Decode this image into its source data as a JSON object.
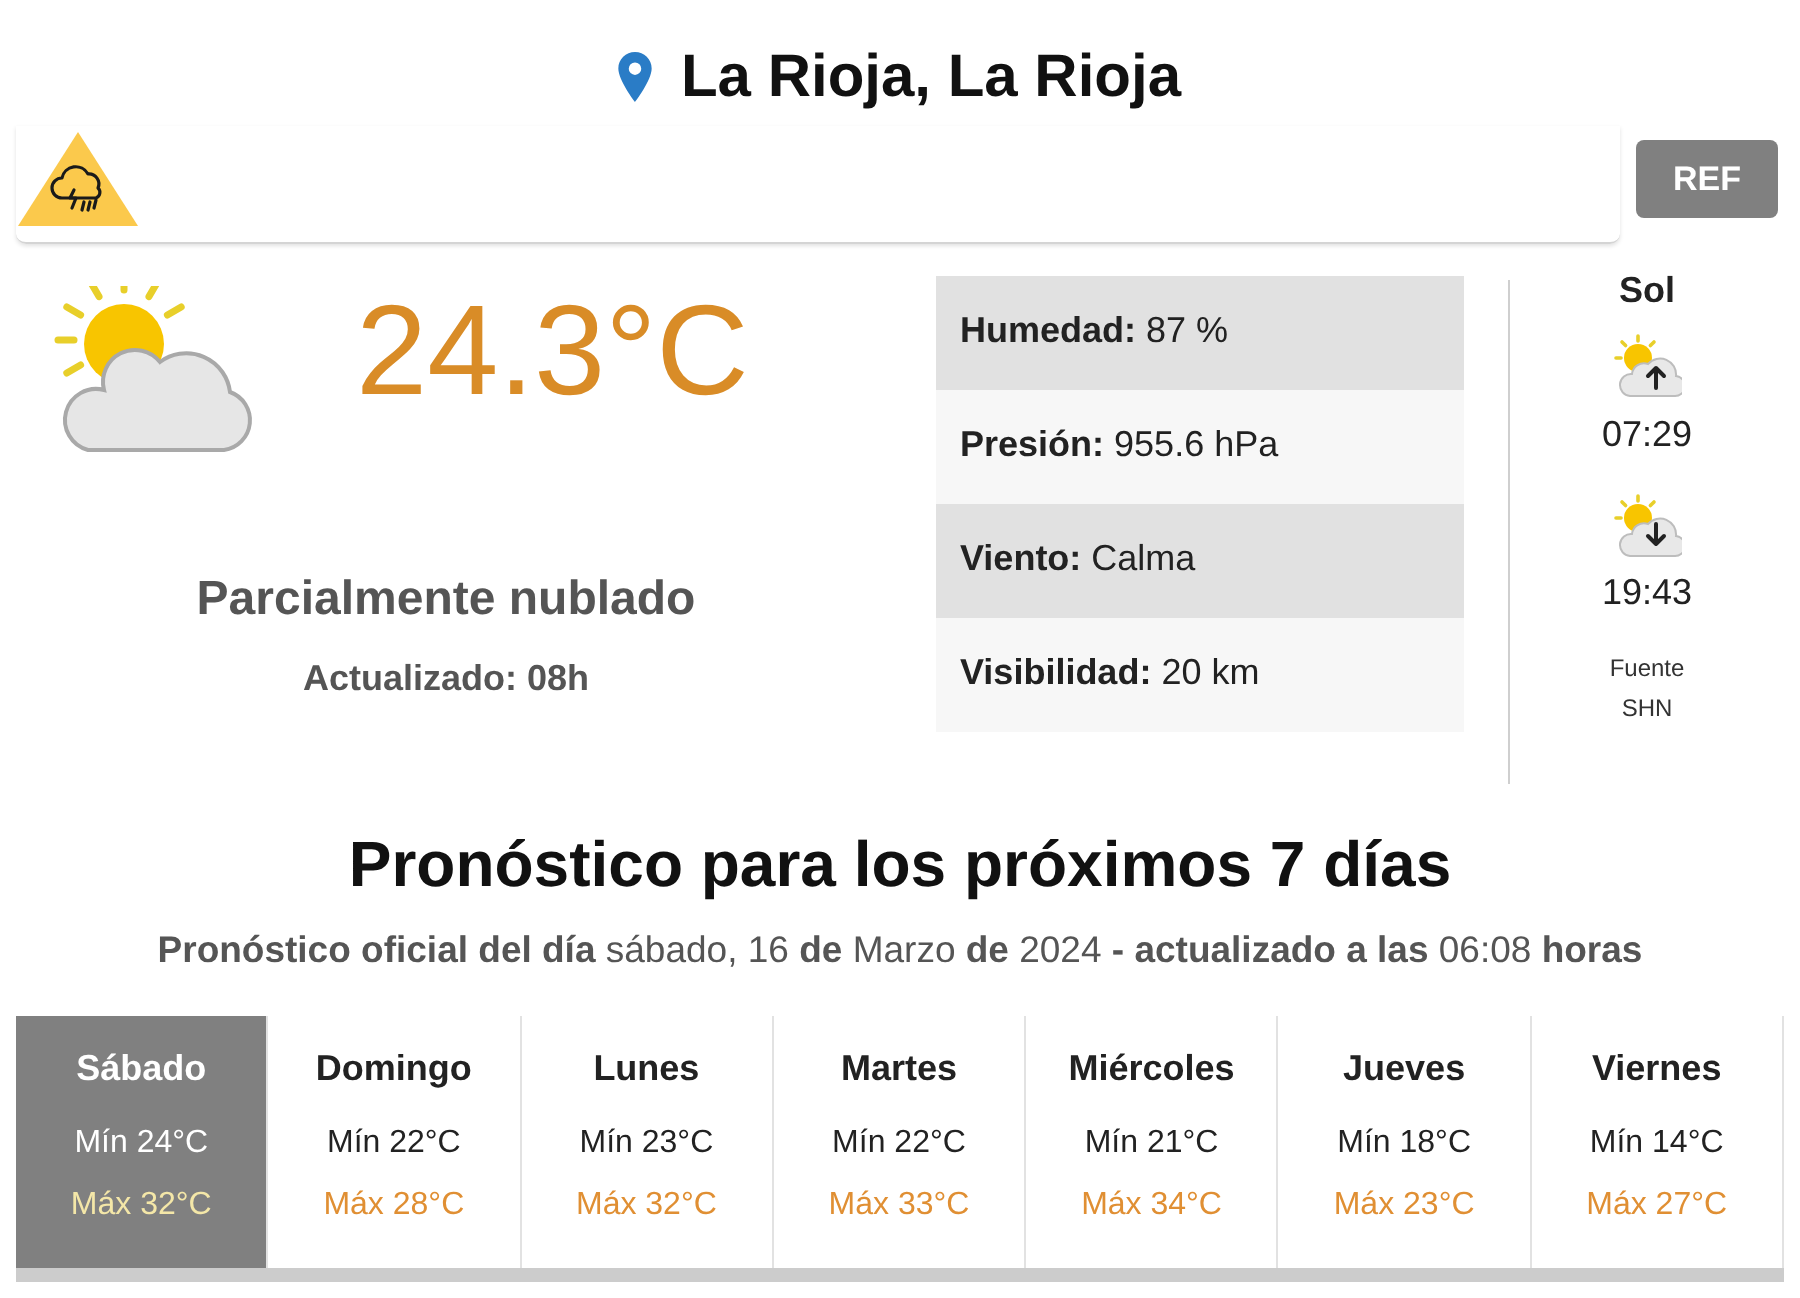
{
  "location": {
    "title": "La Rioja, La Rioja"
  },
  "alert": {
    "button": "REF"
  },
  "current": {
    "temperature": "24.3°C",
    "condition": "Parcialmente nublado",
    "updated": "Actualizado: 08h"
  },
  "details": [
    {
      "label": "Humedad:",
      "value": "87 %"
    },
    {
      "label": "Presión:",
      "value": "955.6 hPa"
    },
    {
      "label": "Viento:",
      "value": "Calma"
    },
    {
      "label": "Visibilidad:",
      "value": "20 km"
    }
  ],
  "sun": {
    "title": "Sol",
    "sunrise": "07:29",
    "sunset": "19:43",
    "source": "Fuente SHN"
  },
  "forecast": {
    "title": "Pronóstico para los próximos 7 días",
    "subtitle": "**Pronóstico oficial del día** sábado, 16 **de** Marzo **de** 2024 **- actualizado a las** 06:08 **horas**",
    "days": [
      {
        "day": "Sábado",
        "min": "Mín 24°C",
        "max": "Máx 32°C",
        "selected": true
      },
      {
        "day": "Domingo",
        "min": "Mín 22°C",
        "max": "Máx 28°C",
        "selected": false
      },
      {
        "day": "Lunes",
        "min": "Mín 23°C",
        "max": "Máx 32°C",
        "selected": false
      },
      {
        "day": "Martes",
        "min": "Mín 22°C",
        "max": "Máx 33°C",
        "selected": false
      },
      {
        "day": "Miércoles",
        "min": "Mín 21°C",
        "max": "Máx 34°C",
        "selected": false
      },
      {
        "day": "Jueves",
        "min": "Mín 18°C",
        "max": "Máx 23°C",
        "selected": false
      },
      {
        "day": "Viernes",
        "min": "Mín 14°C",
        "max": "Máx 27°C",
        "selected": false
      }
    ]
  }
}
